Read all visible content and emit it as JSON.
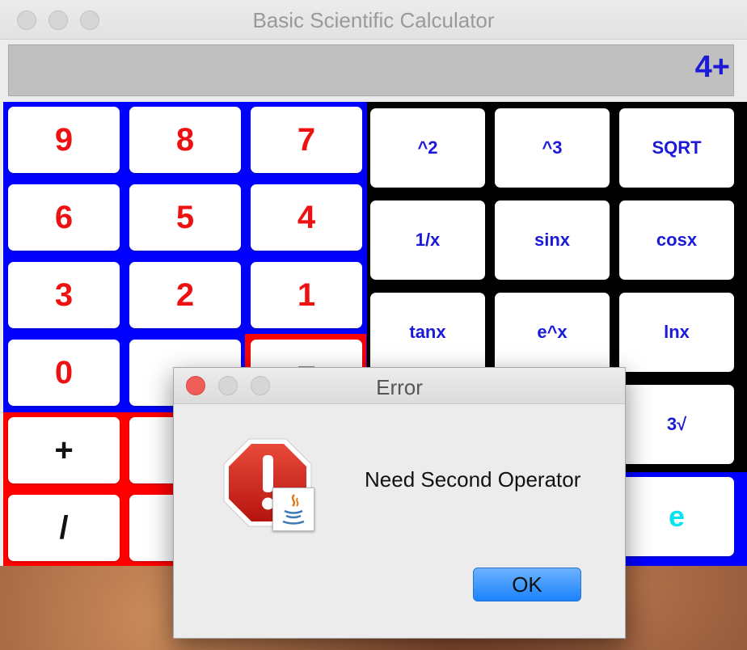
{
  "window": {
    "title": "Basic Scientific Calculator"
  },
  "display": {
    "value": "4+"
  },
  "number_pad": {
    "rows": [
      [
        "9",
        "8",
        "7"
      ],
      [
        "6",
        "5",
        "4"
      ],
      [
        "3",
        "2",
        "1"
      ],
      [
        "0",
        "",
        "="
      ]
    ]
  },
  "scientific_pad": {
    "rows": [
      [
        "^2",
        "^3",
        "SQRT"
      ],
      [
        "1/x",
        "sinx",
        "cosx"
      ],
      [
        "tanx",
        "e^x",
        "lnx"
      ],
      [
        "",
        "",
        "3√"
      ],
      [
        "",
        "",
        "e"
      ]
    ]
  },
  "operator_pad": {
    "rows": [
      [
        "+",
        ""
      ],
      [
        "/",
        "•"
      ]
    ]
  },
  "dialog": {
    "title": "Error",
    "message": "Need Second Operator",
    "ok_label": "OK",
    "icon": "stop-warning-icon"
  },
  "colors": {
    "number_panel_bg": "#0000ff",
    "operator_panel_bg": "#ff0000",
    "scientific_panel_bg": "#000000",
    "number_text": "#ee1111",
    "scientific_text": "#1a1ad8",
    "e_key_text": "#00e5ee"
  }
}
